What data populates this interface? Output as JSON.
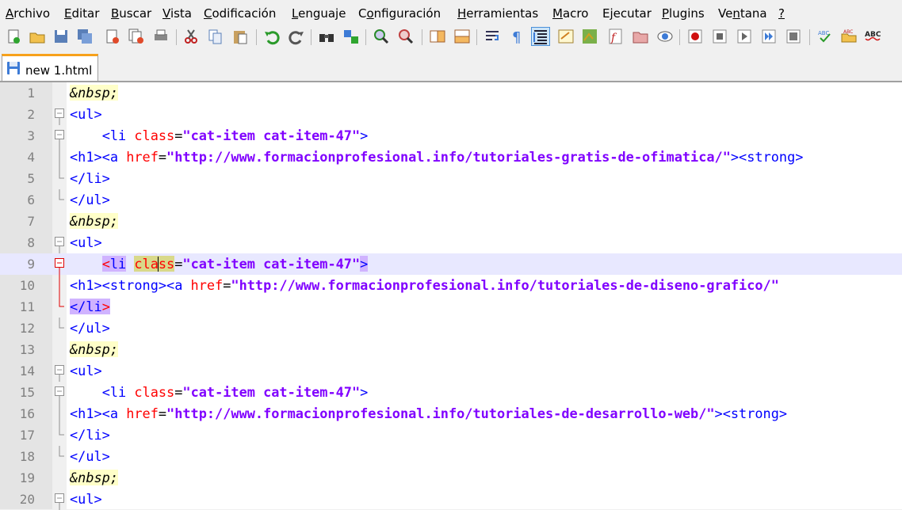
{
  "menu": [
    {
      "pre": "",
      "mn": "A",
      "post": "rchivo"
    },
    {
      "pre": "",
      "mn": "E",
      "post": "ditar"
    },
    {
      "pre": "",
      "mn": "B",
      "post": "uscar"
    },
    {
      "pre": "",
      "mn": "V",
      "post": "ista"
    },
    {
      "pre": "",
      "mn": "C",
      "post": "odificación"
    },
    {
      "pre": "",
      "mn": "L",
      "post": "enguaje"
    },
    {
      "pre": "C",
      "mn": "o",
      "post": "nfiguración"
    },
    {
      "pre": "",
      "mn": "H",
      "post": "erramientas"
    },
    {
      "pre": "",
      "mn": "M",
      "post": "acro"
    },
    {
      "pre": "E",
      "mn": "j",
      "post": "ecutar"
    },
    {
      "pre": "",
      "mn": "P",
      "post": "lugins"
    },
    {
      "pre": "Ve",
      "mn": "n",
      "post": "tana"
    },
    {
      "pre": "",
      "mn": "?",
      "post": ""
    }
  ],
  "toolbar_icons": [
    "new-file-icon",
    "open-file-icon",
    "save-icon",
    "save-all-icon",
    "close-icon",
    "close-all-icon",
    "print-icon",
    "cut-icon",
    "copy-icon",
    "paste-icon",
    "undo-icon",
    "redo-icon",
    "find-icon",
    "replace-icon",
    "zoom-in-icon",
    "zoom-out-icon",
    "sync-vertical-icon",
    "sync-horizontal-icon",
    "word-wrap-icon",
    "show-all-chars-icon",
    "indent-guide-icon",
    "user-language-icon",
    "document-map-icon",
    "function-list-icon",
    "folder-workspace-icon",
    "monitoring-icon",
    "record-macro-icon",
    "stop-macro-icon",
    "play-macro-icon",
    "run-macro-multiple-icon",
    "save-macro-icon",
    "spell-check-icon",
    "spell-folder-icon",
    "abc-icon"
  ],
  "tab": {
    "label": "new 1.html"
  },
  "lines": [
    {
      "n": "1",
      "fold": "none",
      "parts": [
        {
          "t": "&nbsp;",
          "c": "ent"
        }
      ]
    },
    {
      "n": "2",
      "fold": "open",
      "parts": [
        {
          "t": "<ul>",
          "c": "tg"
        }
      ]
    },
    {
      "n": "3",
      "fold": "open",
      "parts": [
        {
          "t": "    ",
          "c": "pn"
        },
        {
          "t": "<li",
          "c": "tg"
        },
        {
          "t": " ",
          "c": "pn"
        },
        {
          "t": "class",
          "c": "at"
        },
        {
          "t": "=",
          "c": "pn"
        },
        {
          "t": "\"cat-item cat-item-47\"",
          "c": "vl"
        },
        {
          "t": ">",
          "c": "tg"
        }
      ]
    },
    {
      "n": "4",
      "fold": "line",
      "parts": [
        {
          "t": "<h1><a",
          "c": "tg"
        },
        {
          "t": " ",
          "c": "pn"
        },
        {
          "t": "href",
          "c": "at"
        },
        {
          "t": "=",
          "c": "pn"
        },
        {
          "t": "\"http://www.formacionprofesional.info/tutoriales-gratis-de-ofimatica/\"",
          "c": "vl"
        },
        {
          "t": "><strong>",
          "c": "tg"
        }
      ]
    },
    {
      "n": "5",
      "fold": "end",
      "parts": [
        {
          "t": "</li>",
          "c": "tg"
        }
      ]
    },
    {
      "n": "6",
      "fold": "end",
      "parts": [
        {
          "t": "</ul>",
          "c": "tg"
        }
      ]
    },
    {
      "n": "7",
      "fold": "none",
      "parts": [
        {
          "t": "&nbsp;",
          "c": "ent"
        }
      ]
    },
    {
      "n": "8",
      "fold": "open",
      "parts": [
        {
          "t": "<ul>",
          "c": "tg"
        }
      ]
    },
    {
      "n": "9",
      "fold": "open-red",
      "current": true,
      "parts": [
        {
          "t": "    ",
          "c": "pn"
        },
        {
          "t": "<",
          "c": "red hlt"
        },
        {
          "t": "li",
          "c": "tg hlt"
        },
        {
          "t": " ",
          "c": "pn"
        },
        {
          "t": "cla",
          "c": "at hlw"
        },
        {
          "t": "CARET",
          "c": "caret"
        },
        {
          "t": "ss",
          "c": "at hlw"
        },
        {
          "t": "=",
          "c": "pn"
        },
        {
          "t": "\"cat-item cat-item-47\"",
          "c": "vl"
        },
        {
          "t": ">",
          "c": "tg hlt"
        }
      ]
    },
    {
      "n": "10",
      "fold": "line-red",
      "parts": [
        {
          "t": "<h1><strong><a",
          "c": "tg"
        },
        {
          "t": " ",
          "c": "pn"
        },
        {
          "t": "href",
          "c": "at"
        },
        {
          "t": "=",
          "c": "pn"
        },
        {
          "t": "\"http://www.formacionprofesional.info/tutoriales-de-diseno-grafico/\"",
          "c": "vl"
        }
      ]
    },
    {
      "n": "11",
      "fold": "end-red",
      "parts": [
        {
          "t": "</li",
          "c": "tg hlt"
        },
        {
          "t": ">",
          "c": "red hlt"
        }
      ]
    },
    {
      "n": "12",
      "fold": "end",
      "parts": [
        {
          "t": "</ul>",
          "c": "tg"
        }
      ]
    },
    {
      "n": "13",
      "fold": "none",
      "parts": [
        {
          "t": "&nbsp;",
          "c": "ent"
        }
      ]
    },
    {
      "n": "14",
      "fold": "open",
      "parts": [
        {
          "t": "<ul>",
          "c": "tg"
        }
      ]
    },
    {
      "n": "15",
      "fold": "open",
      "parts": [
        {
          "t": "    ",
          "c": "pn"
        },
        {
          "t": "<li",
          "c": "tg"
        },
        {
          "t": " ",
          "c": "pn"
        },
        {
          "t": "class",
          "c": "at"
        },
        {
          "t": "=",
          "c": "pn"
        },
        {
          "t": "\"cat-item cat-item-47\"",
          "c": "vl"
        },
        {
          "t": ">",
          "c": "tg"
        }
      ]
    },
    {
      "n": "16",
      "fold": "line",
      "parts": [
        {
          "t": "<h1><a",
          "c": "tg"
        },
        {
          "t": " ",
          "c": "pn"
        },
        {
          "t": "href",
          "c": "at"
        },
        {
          "t": "=",
          "c": "pn"
        },
        {
          "t": "\"http://www.formacionprofesional.info/tutoriales-de-desarrollo-web/\"",
          "c": "vl"
        },
        {
          "t": "><strong>",
          "c": "tg"
        }
      ]
    },
    {
      "n": "17",
      "fold": "end",
      "parts": [
        {
          "t": "</li>",
          "c": "tg"
        }
      ]
    },
    {
      "n": "18",
      "fold": "end",
      "parts": [
        {
          "t": "</ul>",
          "c": "tg"
        }
      ]
    },
    {
      "n": "19",
      "fold": "none",
      "parts": [
        {
          "t": "&nbsp;",
          "c": "ent"
        }
      ]
    },
    {
      "n": "20",
      "fold": "open",
      "parts": [
        {
          "t": "<ul>",
          "c": "tg"
        }
      ]
    }
  ],
  "colors": {
    "tag": "#0000ff",
    "attribute": "#ff0000",
    "value": "#8000ff",
    "entity_bg": "#ffffc8",
    "current_line": "#e8e8ff",
    "brace_match": "#d0b3ff",
    "tab_accent": "#f7a11a"
  }
}
